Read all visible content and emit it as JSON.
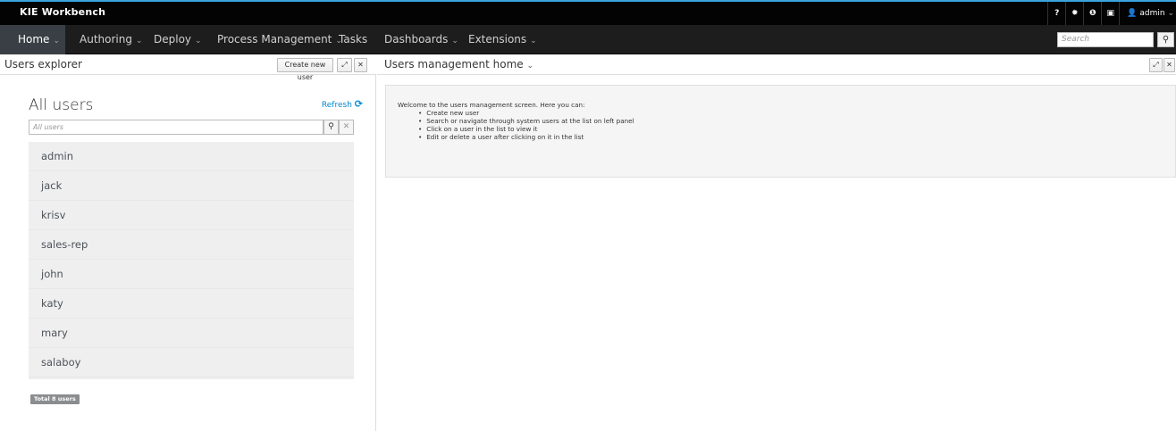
{
  "app": {
    "brand": "KIE Workbench",
    "accent_color": "#39a5dc",
    "help_icon": "?",
    "settings_icon": "gear-icon",
    "info_icon": "info-icon",
    "apps_icon": "briefcase-icon",
    "user_icon": "user-icon",
    "user_label": "admin"
  },
  "nav": {
    "items": [
      {
        "label": "Home",
        "dropdown": true,
        "active": true
      },
      {
        "label": "Authoring",
        "dropdown": true
      },
      {
        "label": "Deploy",
        "dropdown": true
      },
      {
        "label": "Process Management",
        "dropdown": true
      },
      {
        "label": "Tasks",
        "dropdown": false
      },
      {
        "label": "Dashboards",
        "dropdown": true
      },
      {
        "label": "Extensions",
        "dropdown": true
      }
    ],
    "search_placeholder": "Search",
    "search_icon": "search-icon"
  },
  "left_panel": {
    "title": "Users explorer",
    "create_button": "Create new user",
    "maximize_icon": "expand-icon",
    "close_icon": "close-icon",
    "heading": "All users",
    "refresh_label": "Refresh",
    "refresh_icon": "refresh-icon",
    "filter_placeholder": "All users",
    "users": [
      "admin",
      "jack",
      "krisv",
      "sales-rep",
      "john",
      "katy",
      "mary",
      "salaboy"
    ],
    "total_label": "Total 8 users"
  },
  "right_panel": {
    "title": "Users management home",
    "welcome_intro": "Welcome to the users management screen. Here you can:",
    "welcome_items": [
      "Create new user",
      "Search or navigate through system users at the list on left panel",
      "Click on a user in the list to view it",
      "Edit or delete a user after clicking on it in the list"
    ]
  }
}
